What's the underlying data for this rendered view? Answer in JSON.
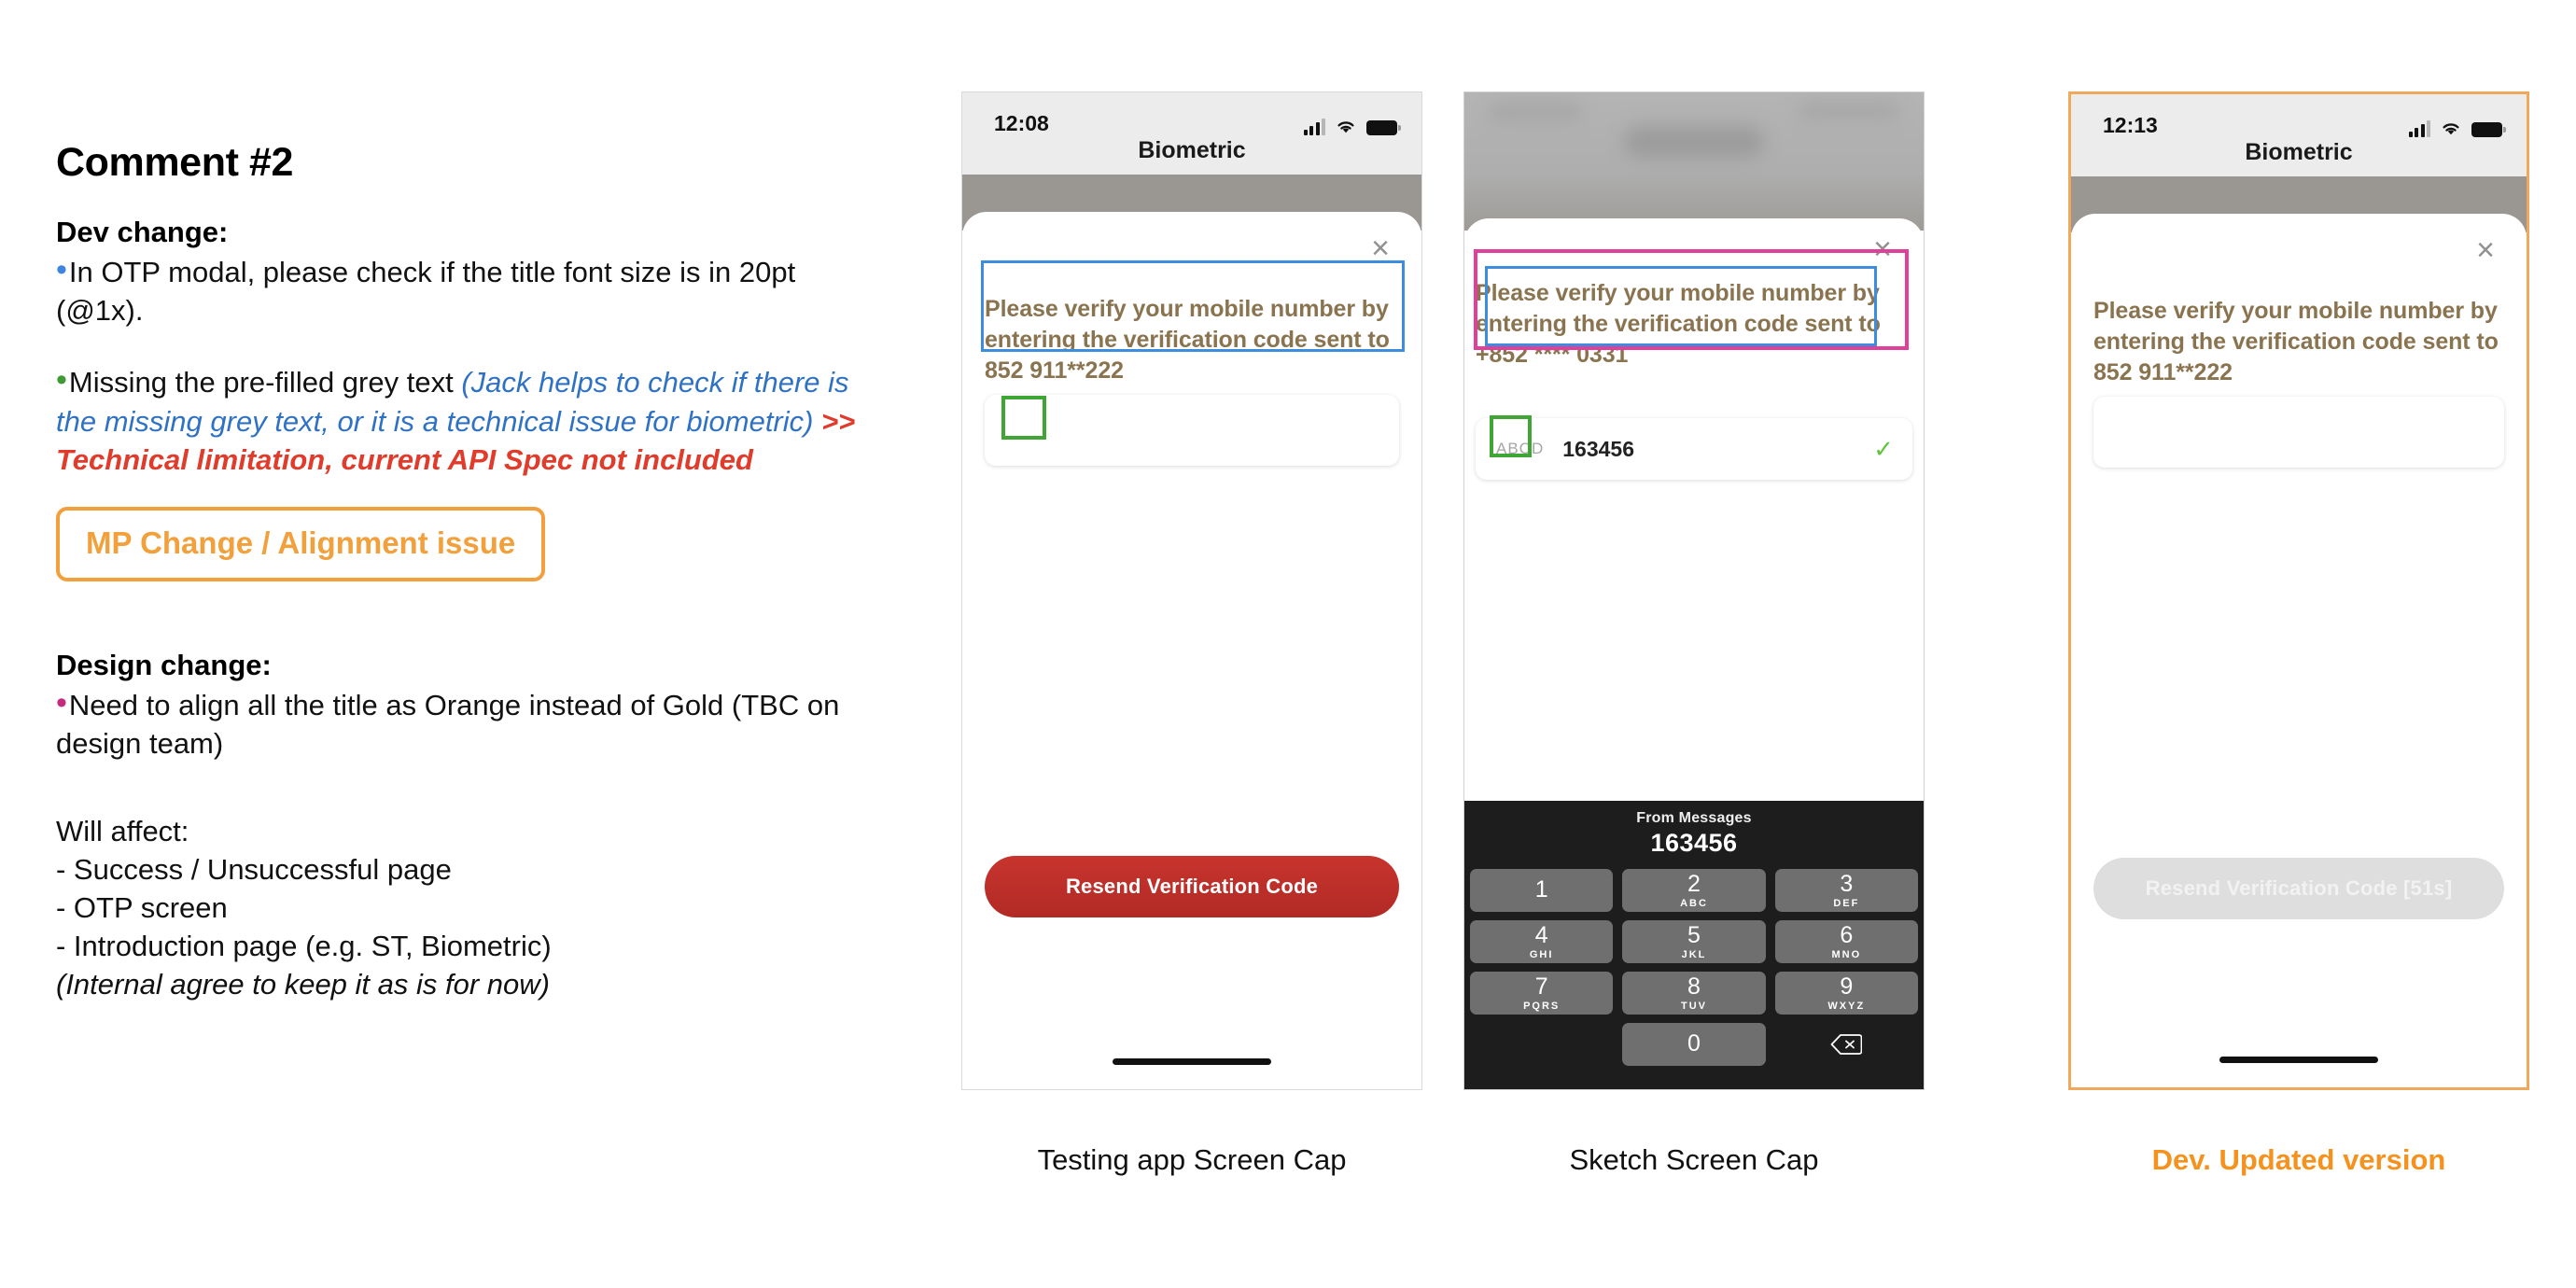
{
  "notes": {
    "title": "Comment #2",
    "dev_change_heading": "Dev change:",
    "bullet1": "In OTP modal, please check if the title font size is in 20pt (@1x).",
    "bullet2_plain": "Missing the pre-filled grey text ",
    "bullet2_blue": "(Jack helps to check if there is the missing grey text, or it is a technical issue for biometric) ",
    "bullet2_red": ">> Technical limitation, current API Spec not included",
    "chip_label": "MP Change / Alignment issue",
    "design_change_heading": "Design change:",
    "design_bullet": "Need to align all the title as Orange instead of Gold (TBC on design team)",
    "will_affect_heading": "Will affect:",
    "affect_1": "- Success / Unsuccessful page",
    "affect_2": "- OTP screen",
    "affect_3": "- Introduction page (e.g. ST, Biometric)",
    "affect_note": "(Internal agree to keep it as is for now)"
  },
  "colors": {
    "orange": "#f2a03c",
    "blue_annotation": "#3c8dde",
    "green_annotation": "#3fa535",
    "pink_annotation": "#e0409a",
    "gold_title": "#8a7450",
    "red_button": "#c8342e",
    "bullet_blue": "#3d85e0",
    "bullet_green": "#3f9a33",
    "bullet_pink": "#c42b7d",
    "caption_orange": "#f5921e"
  },
  "phone1": {
    "caption": "Testing app Screen Cap",
    "status_time": "12:08",
    "nav_title": "Biometric",
    "close_icon": "×",
    "otp_title": "Please verify your mobile number by entering the verification code sent to 852 911**222",
    "otp_input_value": "",
    "resend_label": "Resend Verification Code"
  },
  "phone2": {
    "caption": "Sketch Screen Cap",
    "otp_title": "Please verify your mobile number by entering the verification code sent to +852 **** 0331",
    "close_icon": "×",
    "autofill_hint": "ABCD",
    "code_value": "163456",
    "check_icon": "✓",
    "keyboard": {
      "from_label": "From Messages",
      "suggested_code": "163456",
      "keys": [
        {
          "num": "1",
          "sub": ""
        },
        {
          "num": "2",
          "sub": "ABC"
        },
        {
          "num": "3",
          "sub": "DEF"
        },
        {
          "num": "4",
          "sub": "GHI"
        },
        {
          "num": "5",
          "sub": "JKL"
        },
        {
          "num": "6",
          "sub": "MNO"
        },
        {
          "num": "7",
          "sub": "PQRS"
        },
        {
          "num": "8",
          "sub": "TUV"
        },
        {
          "num": "9",
          "sub": "WXYZ"
        },
        {
          "num": "0",
          "sub": ""
        }
      ],
      "delete_icon": "delete-backward-icon"
    }
  },
  "phone3": {
    "caption": "Dev. Updated version",
    "status_time": "12:13",
    "nav_title": "Biometric",
    "close_icon": "×",
    "otp_title": "Please verify your mobile number by entering the verification code sent to 852 911**222",
    "otp_input_value": "",
    "resend_label": "Resend Verification Code [51s]"
  }
}
